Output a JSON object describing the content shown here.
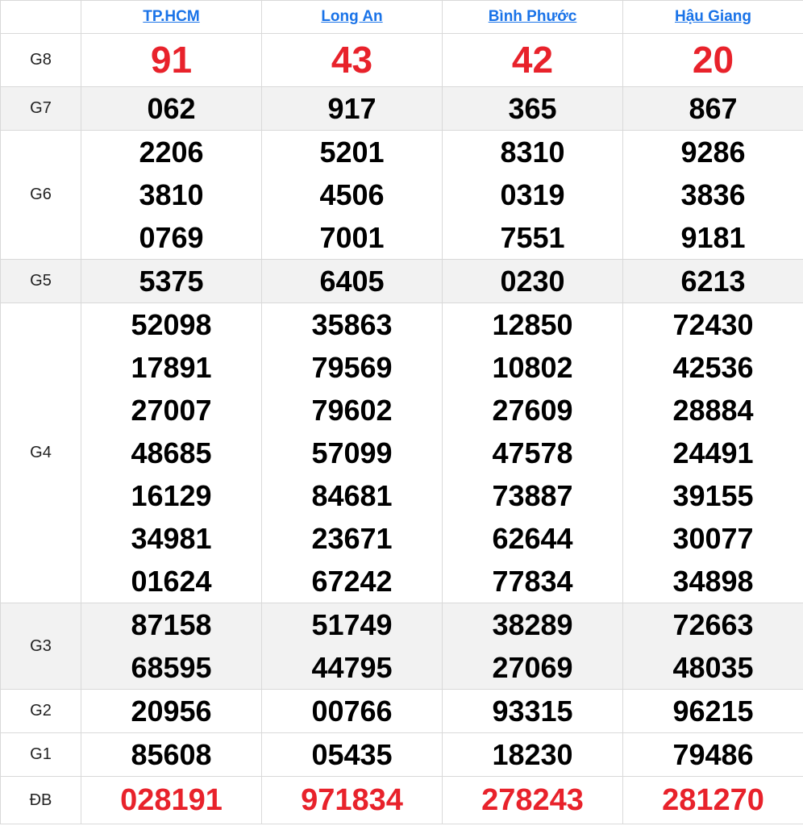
{
  "provinces": [
    "TP.HCM",
    "Long An",
    "Bình Phước",
    "Hậu Giang"
  ],
  "colors": {
    "special": "#e8222b",
    "link": "#1a73e8",
    "shade": "#f2f2f2"
  },
  "rows": [
    {
      "label": "G8",
      "shade": false,
      "cls": "g8",
      "values": [
        [
          "91"
        ],
        [
          "43"
        ],
        [
          "42"
        ],
        [
          "20"
        ]
      ]
    },
    {
      "label": "G7",
      "shade": true,
      "cls": "",
      "values": [
        [
          "062"
        ],
        [
          "917"
        ],
        [
          "365"
        ],
        [
          "867"
        ]
      ]
    },
    {
      "label": "G6",
      "shade": false,
      "cls": "",
      "values": [
        [
          "2206",
          "3810",
          "0769"
        ],
        [
          "5201",
          "4506",
          "7001"
        ],
        [
          "8310",
          "0319",
          "7551"
        ],
        [
          "9286",
          "3836",
          "9181"
        ]
      ]
    },
    {
      "label": "G5",
      "shade": true,
      "cls": "",
      "values": [
        [
          "5375"
        ],
        [
          "6405"
        ],
        [
          "0230"
        ],
        [
          "6213"
        ]
      ]
    },
    {
      "label": "G4",
      "shade": false,
      "cls": "",
      "values": [
        [
          "52098",
          "17891",
          "27007",
          "48685",
          "16129",
          "34981",
          "01624"
        ],
        [
          "35863",
          "79569",
          "79602",
          "57099",
          "84681",
          "23671",
          "67242"
        ],
        [
          "12850",
          "10802",
          "27609",
          "47578",
          "73887",
          "62644",
          "77834"
        ],
        [
          "72430",
          "42536",
          "28884",
          "24491",
          "39155",
          "30077",
          "34898"
        ]
      ]
    },
    {
      "label": "G3",
      "shade": true,
      "cls": "",
      "values": [
        [
          "87158",
          "68595"
        ],
        [
          "51749",
          "44795"
        ],
        [
          "38289",
          "27069"
        ],
        [
          "72663",
          "48035"
        ]
      ]
    },
    {
      "label": "G2",
      "shade": false,
      "cls": "",
      "values": [
        [
          "20956"
        ],
        [
          "00766"
        ],
        [
          "93315"
        ],
        [
          "96215"
        ]
      ]
    },
    {
      "label": "G1",
      "shade": false,
      "cls": "",
      "values": [
        [
          "85608"
        ],
        [
          "05435"
        ],
        [
          "18230"
        ],
        [
          "79486"
        ]
      ]
    },
    {
      "label": "ĐB",
      "shade": false,
      "cls": "db",
      "values": [
        [
          "028191"
        ],
        [
          "971834"
        ],
        [
          "278243"
        ],
        [
          "281270"
        ]
      ]
    }
  ]
}
